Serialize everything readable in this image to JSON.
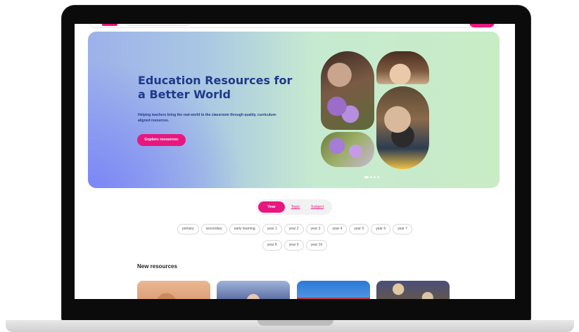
{
  "hero": {
    "title": "Education Resources for a Better World",
    "subtitle": "Helping teachers bring the real-world to the classroom through quality, curriculum-aligned resources.",
    "cta_label": "Explore resources"
  },
  "tabs": [
    {
      "label": "Year",
      "active": true
    },
    {
      "label": "Topic",
      "active": false
    },
    {
      "label": "Subject",
      "active": false
    }
  ],
  "chips_row1": [
    "primary",
    "secondary",
    "early learning",
    "year 1",
    "year 2",
    "year 3",
    "year 4",
    "year 5",
    "year 6",
    "year 7"
  ],
  "chips_row2": [
    "year 8",
    "year 9",
    "year 10"
  ],
  "new_resources": {
    "heading": "New resources"
  },
  "colors": {
    "brand": "#e8177f",
    "title": "#1f3a8a"
  }
}
